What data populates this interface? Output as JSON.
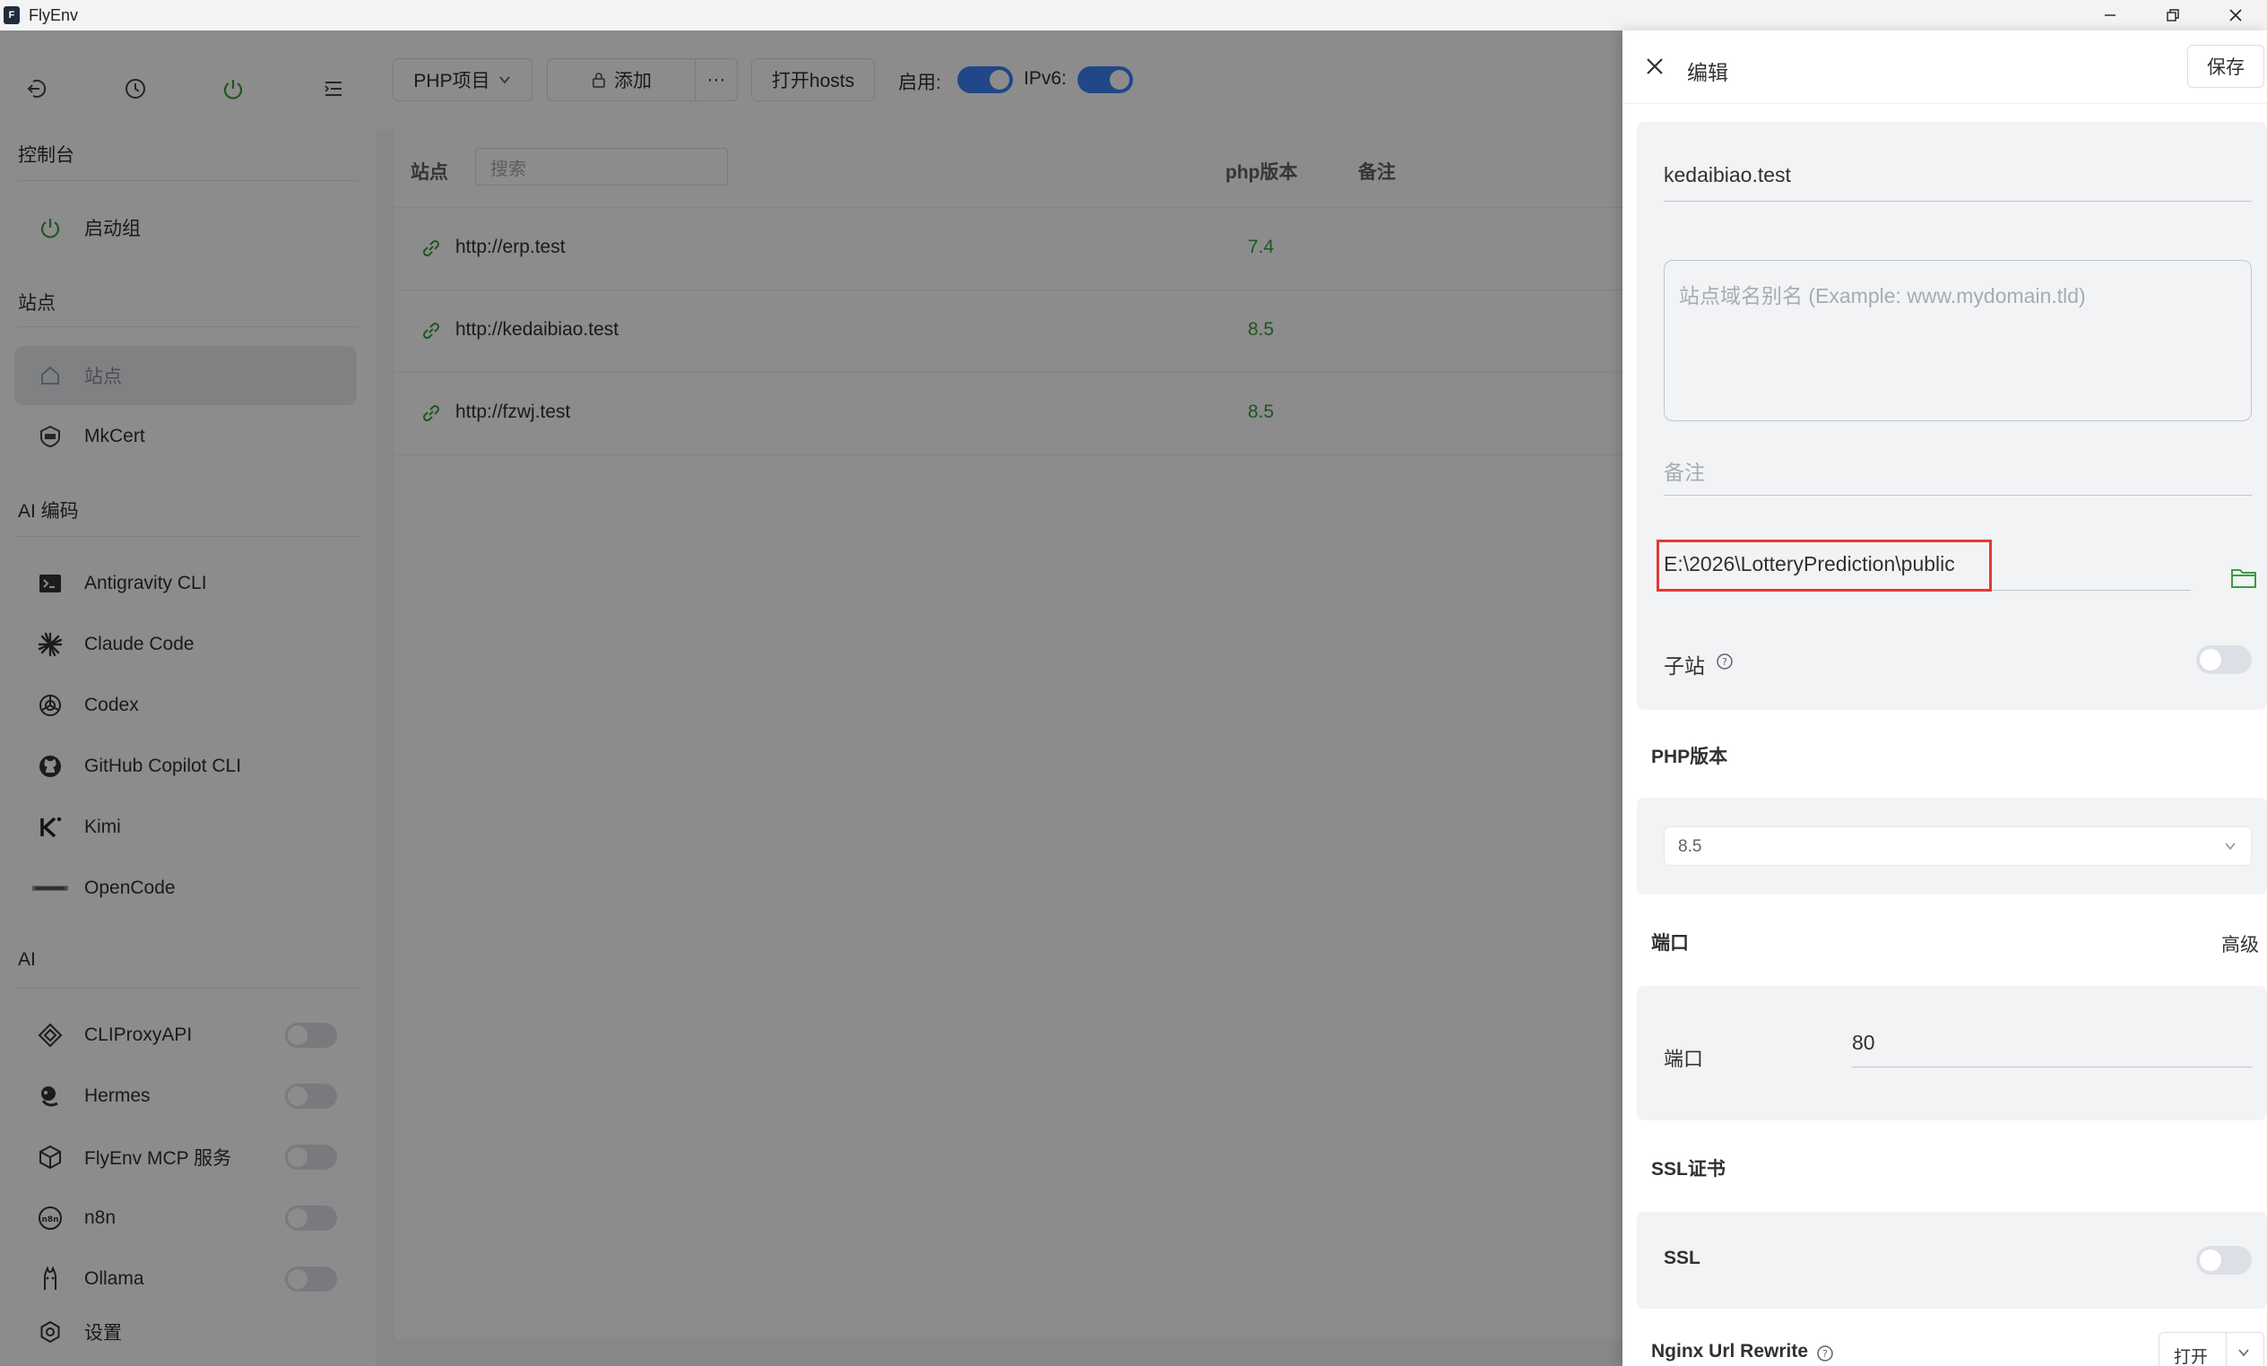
{
  "window": {
    "title": "FlyEnv",
    "controls": [
      "minimize-icon",
      "restore-icon",
      "close-icon"
    ]
  },
  "sidebar": {
    "top_icons": [
      "logout-icon",
      "history-icon",
      "power-icon",
      "menu-list-icon"
    ],
    "sections": {
      "console": "控制台",
      "sites": "站点",
      "ai_coding": "AI 编码",
      "ai": "AI"
    },
    "items": {
      "startup_group": "启动组",
      "sites": "站点",
      "mkcert": "MkCert",
      "antigravity": "Antigravity CLI",
      "claude": "Claude Code",
      "codex": "Codex",
      "copilot": "GitHub Copilot CLI",
      "kimi": "Kimi",
      "opencode": "OpenCode",
      "cliproxy": "CLIProxyAPI",
      "hermes": "Hermes",
      "mcp": "FlyEnv MCP 服务",
      "n8n": "n8n",
      "ollama": "Ollama",
      "settings": "设置"
    }
  },
  "toolbar": {
    "project_dropdown": "PHP项目",
    "add_label": "添加",
    "more_label": "···",
    "open_hosts": "打开hosts",
    "enable_label": "启用:",
    "ipv6_label": "IPv6:"
  },
  "table": {
    "headers": {
      "site": "站点",
      "php_version": "php版本",
      "note": "备注"
    },
    "search_placeholder": "搜索",
    "rows": [
      {
        "url": "http://erp.test",
        "php": "7.4"
      },
      {
        "url": "http://kedaibiao.test",
        "php": "8.5"
      },
      {
        "url": "http://fzwj.test",
        "php": "8.5"
      }
    ]
  },
  "drawer": {
    "title": "编辑",
    "save_label": "保存",
    "domain_value": "kedaibiao.test",
    "alias_placeholder": "站点域名别名 (Example: www.mydomain.tld)",
    "note_placeholder": "备注",
    "root_path": "E:\\2026\\LotteryPrediction\\public",
    "subsite_label": "子站",
    "php_version_title": "PHP版本",
    "php_version_value": "8.5",
    "port_title": "端口",
    "advanced_label": "高级",
    "port_label": "端口",
    "port_value": "80",
    "ssl_title": "SSL证书",
    "ssl_label": "SSL",
    "rewrite_label": "Nginx Url Rewrite",
    "rewrite_open": "打开"
  },
  "colors": {
    "accent_blue": "#3b82f6",
    "green": "#3a9d3f",
    "highlight_red": "#e53935"
  }
}
